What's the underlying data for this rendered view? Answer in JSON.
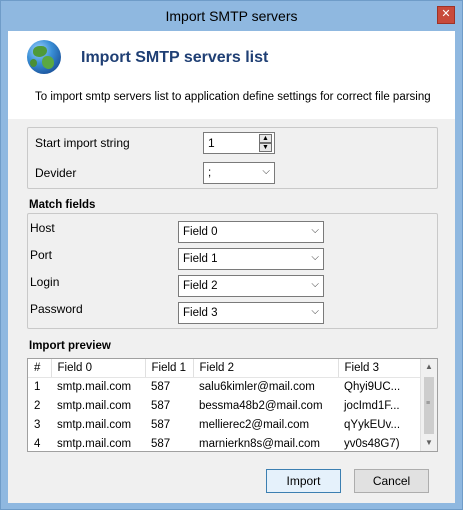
{
  "window": {
    "title": "Import SMTP servers",
    "close_glyph": "✕"
  },
  "header": {
    "icon": "globe-icon",
    "title": "Import SMTP servers list",
    "description": "To import smtp servers list to application define settings for correct file parsing"
  },
  "settings": {
    "start_import_label": "Start import string",
    "start_import_value": "1",
    "devider_label": "Devider",
    "devider_value": ";"
  },
  "match_fields": {
    "title": "Match fields",
    "rows": [
      {
        "label": "Host",
        "value": "Field 0"
      },
      {
        "label": "Port",
        "value": "Field 1"
      },
      {
        "label": "Login",
        "value": "Field 2"
      },
      {
        "label": "Password",
        "value": "Field 3"
      }
    ]
  },
  "preview": {
    "title": "Import preview",
    "columns": [
      "#",
      "Field 0",
      "Field 1",
      "Field 2",
      "Field 3"
    ],
    "rows": [
      [
        "1",
        "smtp.mail.com",
        "587",
        "salu6kimler@mail.com",
        "Qhyi9UC..."
      ],
      [
        "2",
        "smtp.mail.com",
        "587",
        "bessma48b2@mail.com",
        "jocImd1F..."
      ],
      [
        "3",
        "smtp.mail.com",
        "587",
        "mellierec2@mail.com",
        "qYykEUv..."
      ],
      [
        "4",
        "smtp.mail.com",
        "587",
        "marnierkn8s@mail.com",
        "yv0s48G7)"
      ]
    ]
  },
  "buttons": {
    "import": "Import",
    "cancel": "Cancel"
  },
  "colors": {
    "frame": "#8fb8e0",
    "title_text": "#1f3f74",
    "close": "#c84a3b",
    "primary_border": "#3c7fb1"
  }
}
